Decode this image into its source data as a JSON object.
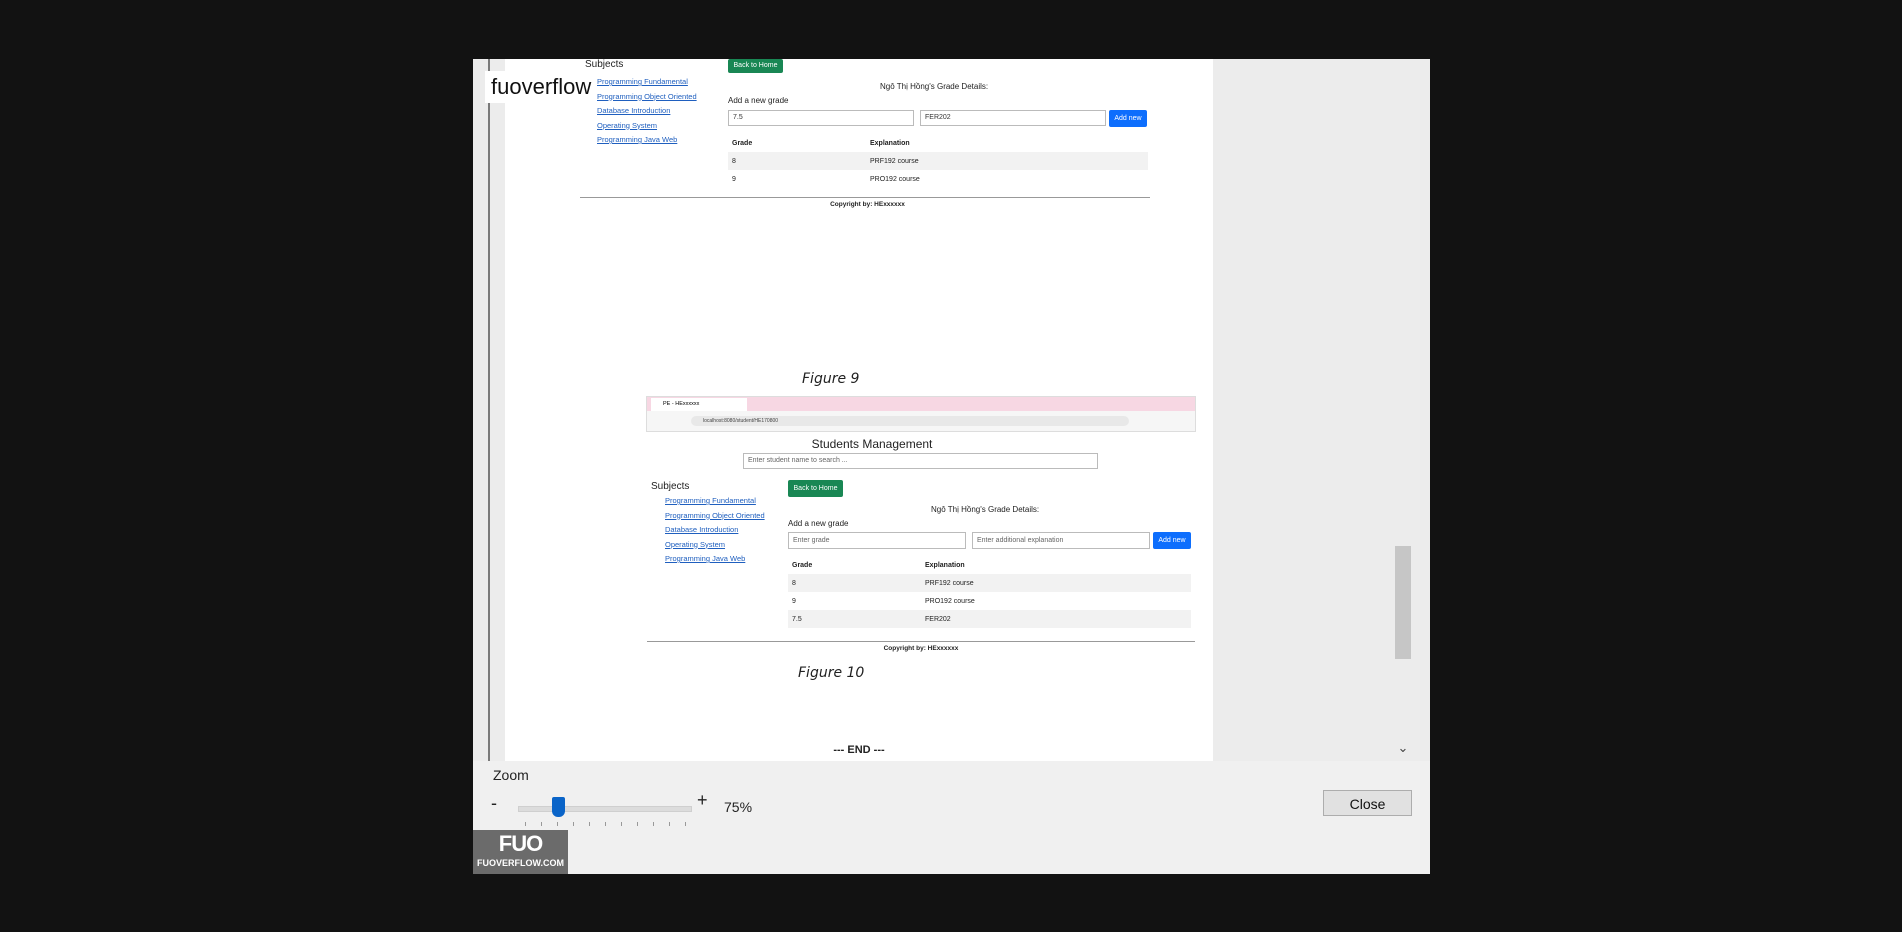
{
  "watermark_text": "fuoverflow",
  "fig9": {
    "subjects_title": "Subjects",
    "back_button": "Back to Home",
    "details_title": "Ngô Thị Hồng's Grade Details:",
    "add_label": "Add a new grade",
    "grade_value": "7.5",
    "explanation_value": "FER202",
    "add_button": "Add new",
    "col_grade": "Grade",
    "col_explanation": "Explanation",
    "rows": [
      {
        "grade": "8",
        "explanation": "PRF192 course"
      },
      {
        "grade": "9",
        "explanation": "PRO192 course"
      }
    ],
    "links": [
      "Programming Fundamental",
      "Programming Object Oriented",
      "Database Introduction",
      "Operating System",
      "Programming Java Web"
    ],
    "copyright": "Copyright by: HExxxxxx"
  },
  "caption9": "Figure 9",
  "fig10": {
    "tab_title": "PE - HExxxxxx",
    "address": "localhost:8080/student/HE170800",
    "app_title": "Students Management",
    "search_placeholder": "Enter student name to search ...",
    "subjects_title": "Subjects",
    "back_button": "Back to Home",
    "details_title": "Ngô Thị Hồng's Grade Details:",
    "add_label": "Add a new grade",
    "grade_placeholder": "Enter grade",
    "explanation_placeholder": "Enter additional explanation",
    "add_button": "Add new",
    "col_grade": "Grade",
    "col_explanation": "Explanation",
    "rows": [
      {
        "grade": "8",
        "explanation": "PRF192 course"
      },
      {
        "grade": "9",
        "explanation": "PRO192 course"
      },
      {
        "grade": "7.5",
        "explanation": "FER202"
      }
    ],
    "links": [
      "Programming Fundamental",
      "Programming Object Oriented",
      "Database Introduction",
      "Operating System",
      "Programming Java Web"
    ],
    "copyright": "Copyright by: HExxxxxx"
  },
  "caption10": "Figure 10",
  "end_text": "--- END ---",
  "zoom": {
    "label": "Zoom",
    "minus": "-",
    "plus": "+",
    "value": "75%",
    "level_fraction": 0.25
  },
  "close_button": "Close",
  "logo": {
    "big": "FUO",
    "small": "FUOVERFLOW.COM"
  }
}
